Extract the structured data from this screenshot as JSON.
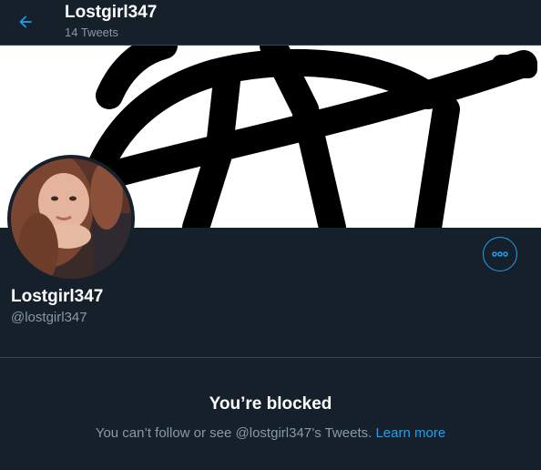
{
  "header": {
    "title": "Lostgirl347",
    "subtitle": "14 Tweets",
    "back_icon": "arrow-left-icon"
  },
  "profile": {
    "display_name": "Lostgirl347",
    "handle": "@lostgirl347",
    "more_icon": "more-horizontal-icon"
  },
  "blocked": {
    "title": "You’re blocked",
    "message": "You can’t follow or see @lostgirl347’s Tweets.",
    "learn_more": "Learn more"
  },
  "colors": {
    "background": "#15202b",
    "accent": "#1da1f2",
    "text_primary": "#ffffff",
    "text_secondary": "#8899a6",
    "divider": "#38444d"
  }
}
